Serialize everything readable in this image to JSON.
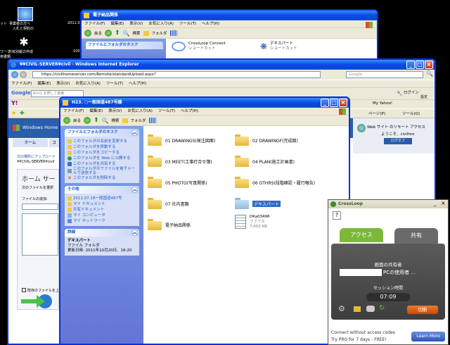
{
  "desktop": {
    "icon_top_label1": "ット",
    "icon_top_label2": "事業者の方へ",
    "icon_top_label3": "入札と契約の",
    "icon_top_date": "2011.07",
    "icon_mid_label1": "ワーク",
    "icon_mid_label2": "共有別紙の作成",
    "icon_mid_label3": "用書類",
    "icon_mid_num": "100"
  },
  "win_back": {
    "title": "電子納品関係",
    "menu": [
      "ファイル(F)",
      "編集(E)",
      "表示(V)",
      "お気に入り(A)",
      "ツール(T)",
      "ヘルプ(H)"
    ],
    "back_label": "戻る",
    "search_label": "検索",
    "folder_label": "フォルダ",
    "task_header": "ファイルとフォルダのタスク",
    "item1_line1": "CrossLoop Connect",
    "item1_line2": "ショートカット",
    "item2_line1": "デキスパート",
    "item2_line2": "ショートカット"
  },
  "ie": {
    "title": "¥¥CIVIL-SERVER¥civil - Windows Internet Explorer",
    "url": "https://civilhomeserver.com/Remote/standardUpload.aspx?",
    "search_placeholder": "Google",
    "menu": [
      "ファイル(F)",
      "編集(E)",
      "表示(V)",
      "お気に入り(A)",
      "ツール(T)",
      "ヘルプ(H)"
    ],
    "google_label": "Google",
    "google_search": "Al+G を押して検索",
    "login_label": "ログイン",
    "settings_label": "設定",
    "yahoo_label": "My Yahoo!",
    "page_label": "ページ(P)",
    "tools_label": "ツール(O)",
    "whs_title": "Windows Home S",
    "tab_home": "ホーム",
    "tab_comp": "コ",
    "upload_title": "次の場所にアップロード",
    "upload_path": "¥¥CIVIL-SERVER¥civil",
    "home_heading": "ホーム サー",
    "home_sub": "次のファイルを選択",
    "file_label": "ファイルの追加:",
    "overwrite": "既存のファイルを上",
    "web_text": "Web サイト のリモート アクセス",
    "web_sub": "ようこそ、civilhro",
    "logout": "ログオフ"
  },
  "explorer": {
    "title": "H23. ○一般国道487号線",
    "menu": [
      "ファイル(F)",
      "編集(E)",
      "表示(V)",
      "お気に入り(A)",
      "ツール(T)",
      "ヘルプ(H)"
    ],
    "back_label": "戻る",
    "search_label": "検索",
    "folder_label": "フォルダ",
    "tasks_header": "ファイルとフォルダのタスク",
    "tasks": [
      "このフォルダの名前を変更する",
      "このフォルダを移動する",
      "このフォルダをコピーする",
      "このフォルダを Web に公開する",
      "このフォルダを共有する",
      "このフォルダのファイルを電子メールで送信する",
      "このフォルダを削除する"
    ],
    "other_header": "その他",
    "other": [
      "2011.07.18一般国道487号",
      "マイ ドキュメント",
      "共有ドキュメント",
      "マイ コンピュータ",
      "マイ ネットワーク"
    ],
    "detail_header": "詳細",
    "detail_name": "デキスパート",
    "detail_type": "ファイル フォルダ",
    "detail_date": "更新日時: 2011年10月20日、16:20",
    "folders": [
      "01 DRAWINGS(発注図面)",
      "02 DRAWINGF(完成図)",
      "03 MEET(工事打合せ簿)",
      "04 PLAN(施工計画書)",
      "05 PHOTO(写真関係)",
      "06 OTHRS(段階確認・履行報告)",
      "07 社内書類",
      "デキスパート",
      "電子納品関係"
    ],
    "file_name": "DKa03496",
    "file_type": "ファイル",
    "file_size": "7,402 KB"
  },
  "crossloop": {
    "title": "CrossLoop",
    "tab_access": "アクセス",
    "tab_share": "共有",
    "sharer_label": "画面の共有者",
    "pc_user_suffix": "PCの使用者 ...",
    "session_label": "セッション時間",
    "session_time": "07:09",
    "disconnect": "切断",
    "promo_line1": "Connect without access codes",
    "promo_line2": "Try PRO for 7 days - FREE!",
    "learn_more": "Learn More"
  }
}
